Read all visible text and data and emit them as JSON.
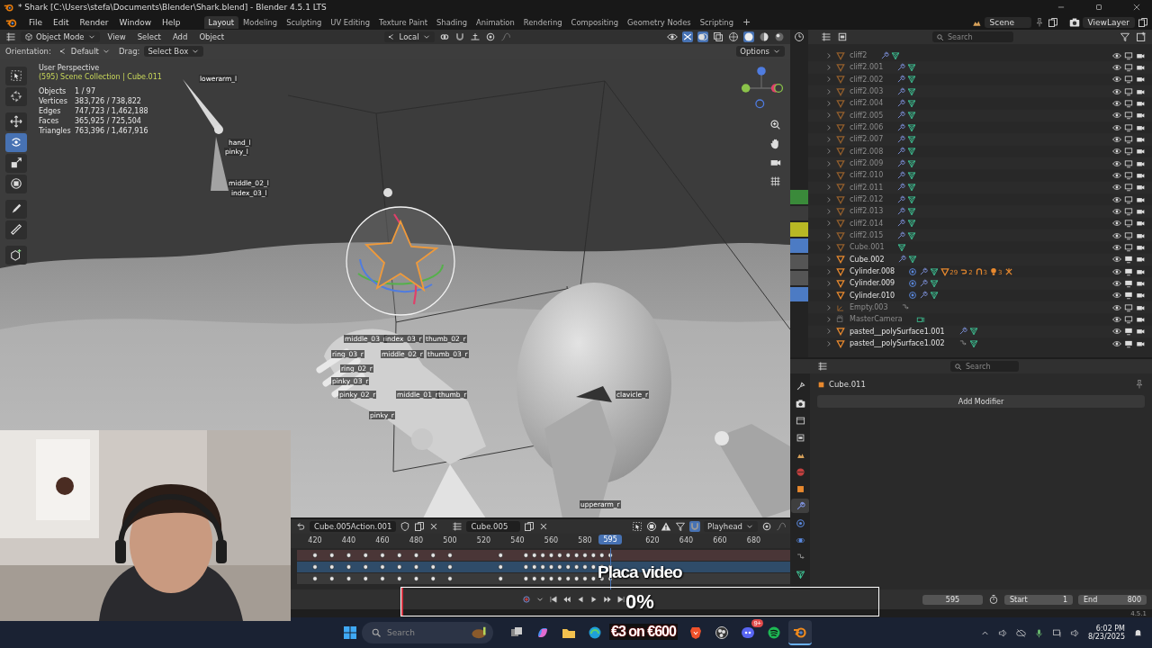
{
  "window": {
    "title": "* Shark [C:\\Users\\stefa\\Documents\\Blender\\Shark.blend] - Blender 4.5.1 LTS"
  },
  "menu": [
    "File",
    "Edit",
    "Render",
    "Window",
    "Help"
  ],
  "workspaces": [
    {
      "label": "Layout",
      "selected": true
    },
    {
      "label": "Modeling",
      "selected": false
    },
    {
      "label": "Sculpting",
      "selected": false
    },
    {
      "label": "UV Editing",
      "selected": false
    },
    {
      "label": "Texture Paint",
      "selected": false
    },
    {
      "label": "Shading",
      "selected": false
    },
    {
      "label": "Animation",
      "selected": false
    },
    {
      "label": "Rendering",
      "selected": false
    },
    {
      "label": "Compositing",
      "selected": false
    },
    {
      "label": "Geometry Nodes",
      "selected": false
    },
    {
      "label": "Scripting",
      "selected": false
    }
  ],
  "add_workspace": "+",
  "scene": {
    "value": "Scene"
  },
  "view_layer": {
    "value": "ViewLayer"
  },
  "viewport": {
    "header": {
      "mode": "Object Mode",
      "menus": [
        "View",
        "Select",
        "Add",
        "Object"
      ],
      "pivot": "Local"
    },
    "tool_settings": {
      "orientation_label": "Orientation:",
      "orientation": "Default",
      "drag_label": "Drag:",
      "drag": "Select Box",
      "options": "Options"
    },
    "tools": [
      {
        "kind": "select",
        "selected": false
      },
      {
        "kind": "cursor",
        "selected": false
      },
      {
        "kind": "move",
        "selected": false
      },
      {
        "kind": "rotate",
        "selected": true
      },
      {
        "kind": "scale",
        "selected": false
      },
      {
        "kind": "transform",
        "selected": false
      },
      {
        "kind": "annotate",
        "selected": false
      },
      {
        "kind": "measure",
        "selected": false
      },
      {
        "kind": "add-cube",
        "selected": false
      }
    ],
    "info": {
      "view": "User Perspective",
      "context": "(595) Scene Collection | Cube.011",
      "stats": [
        {
          "label": "Objects",
          "value": "1 / 97"
        },
        {
          "label": "Vertices",
          "value": "383,726 / 738,822"
        },
        {
          "label": "Edges",
          "value": "747,723 / 1,462,188"
        },
        {
          "label": "Faces",
          "value": "365,925 / 725,504"
        },
        {
          "label": "Triangles",
          "value": "763,396 / 1,467,916"
        }
      ]
    },
    "bone_labels": [
      "lowerarm_l",
      "hand_l",
      "pinky_l",
      "middle_02_l",
      "index_03_l",
      "middle_03_r",
      "index_03_r",
      "thumb_02_r",
      "ring_03_r",
      "middle_02_r",
      "thumb_03_r",
      "ring_02_r",
      "pinky_03_r",
      "pinky_02_r",
      "middle_01_r",
      "thumb_r",
      "clavicle_r",
      "pinky_r",
      "upperarm_r"
    ]
  },
  "outliner": {
    "search": {
      "placeholder": "Search"
    },
    "rows": [
      {
        "name": "cliff2",
        "kind": "mesh",
        "dimmed": true,
        "badges": [
          {
            "kind": "modifier"
          },
          {
            "kind": "mesh-data"
          }
        ]
      },
      {
        "name": "cliff2.001",
        "kind": "mesh",
        "dimmed": true,
        "badges": [
          {
            "kind": "modifier"
          },
          {
            "kind": "mesh-data"
          }
        ]
      },
      {
        "name": "cliff2.002",
        "kind": "mesh",
        "dimmed": true,
        "badges": [
          {
            "kind": "modifier"
          },
          {
            "kind": "mesh-data"
          }
        ]
      },
      {
        "name": "cliff2.003",
        "kind": "mesh",
        "dimmed": true,
        "badges": [
          {
            "kind": "modifier"
          },
          {
            "kind": "mesh-data"
          }
        ]
      },
      {
        "name": "cliff2.004",
        "kind": "mesh",
        "dimmed": true,
        "badges": [
          {
            "kind": "modifier"
          },
          {
            "kind": "mesh-data"
          }
        ]
      },
      {
        "name": "cliff2.005",
        "kind": "mesh",
        "dimmed": true,
        "badges": [
          {
            "kind": "modifier"
          },
          {
            "kind": "mesh-data"
          }
        ]
      },
      {
        "name": "cliff2.006",
        "kind": "mesh",
        "dimmed": true,
        "badges": [
          {
            "kind": "modifier"
          },
          {
            "kind": "mesh-data"
          }
        ]
      },
      {
        "name": "cliff2.007",
        "kind": "mesh",
        "dimmed": true,
        "badges": [
          {
            "kind": "modifier"
          },
          {
            "kind": "mesh-data"
          }
        ]
      },
      {
        "name": "cliff2.008",
        "kind": "mesh",
        "dimmed": true,
        "badges": [
          {
            "kind": "modifier"
          },
          {
            "kind": "mesh-data"
          }
        ]
      },
      {
        "name": "cliff2.009",
        "kind": "mesh",
        "dimmed": true,
        "badges": [
          {
            "kind": "modifier"
          },
          {
            "kind": "mesh-data"
          }
        ]
      },
      {
        "name": "cliff2.010",
        "kind": "mesh",
        "dimmed": true,
        "badges": [
          {
            "kind": "modifier"
          },
          {
            "kind": "mesh-data"
          }
        ]
      },
      {
        "name": "cliff2.011",
        "kind": "mesh",
        "dimmed": true,
        "badges": [
          {
            "kind": "modifier"
          },
          {
            "kind": "mesh-data"
          }
        ]
      },
      {
        "name": "cliff2.012",
        "kind": "mesh",
        "dimmed": true,
        "badges": [
          {
            "kind": "modifier"
          },
          {
            "kind": "mesh-data"
          }
        ]
      },
      {
        "name": "cliff2.013",
        "kind": "mesh",
        "dimmed": true,
        "badges": [
          {
            "kind": "modifier"
          },
          {
            "kind": "mesh-data"
          }
        ]
      },
      {
        "name": "cliff2.014",
        "kind": "mesh",
        "dimmed": true,
        "badges": [
          {
            "kind": "modifier"
          },
          {
            "kind": "mesh-data"
          }
        ]
      },
      {
        "name": "cliff2.015",
        "kind": "mesh",
        "dimmed": true,
        "badges": [
          {
            "kind": "modifier"
          },
          {
            "kind": "mesh-data"
          }
        ]
      },
      {
        "name": "Cube.001",
        "kind": "mesh",
        "dimmed": true,
        "badges": [
          {
            "kind": "mesh-data"
          }
        ]
      },
      {
        "name": "Cube.002",
        "kind": "mesh",
        "dimmed": false,
        "badges": [
          {
            "kind": "modifier"
          },
          {
            "kind": "mesh-data"
          }
        ]
      },
      {
        "name": "Cylinder.008",
        "kind": "mesh",
        "dimmed": false,
        "badges": [
          {
            "kind": "particles"
          },
          {
            "kind": "modifier"
          },
          {
            "kind": "mesh-data"
          },
          {
            "kind": "vertex-groups",
            "count": "29"
          },
          {
            "kind": "hook",
            "count": "2"
          },
          {
            "kind": "curve",
            "count": "3"
          },
          {
            "kind": "light",
            "count": "3"
          },
          {
            "kind": "pose"
          }
        ]
      },
      {
        "name": "Cylinder.009",
        "kind": "mesh",
        "dimmed": false,
        "badges": [
          {
            "kind": "particles"
          },
          {
            "kind": "modifier"
          },
          {
            "kind": "mesh-data"
          }
        ]
      },
      {
        "name": "Cylinder.010",
        "kind": "mesh",
        "dimmed": false,
        "badges": [
          {
            "kind": "particles"
          },
          {
            "kind": "modifier"
          },
          {
            "kind": "mesh-data"
          }
        ]
      },
      {
        "name": "Empty.003",
        "kind": "empty",
        "dimmed": true,
        "badges": [
          {
            "kind": "constraint"
          }
        ]
      },
      {
        "name": "MasterCamera",
        "kind": "camera",
        "dimmed": true,
        "badges": [
          {
            "kind": "camera-data"
          }
        ]
      },
      {
        "name": "pasted__polySurface1.001",
        "kind": "mesh",
        "dimmed": false,
        "badges": [
          {
            "kind": "modifier"
          },
          {
            "kind": "mesh-data"
          }
        ]
      },
      {
        "name": "pasted__polySurface1.002",
        "kind": "mesh",
        "dimmed": false,
        "badges": [
          {
            "kind": "constraint"
          },
          {
            "kind": "mesh-data"
          }
        ]
      }
    ]
  },
  "properties": {
    "search": {
      "placeholder": "Search"
    },
    "object": "Cube.011",
    "add_modifier": "Add Modifier",
    "tabs": [
      {
        "kind": "tool",
        "selected": false
      },
      {
        "kind": "render",
        "selected": false
      },
      {
        "kind": "output",
        "selected": false
      },
      {
        "kind": "view-layer",
        "selected": false
      },
      {
        "kind": "scene",
        "selected": false
      },
      {
        "kind": "world",
        "selected": false
      },
      {
        "kind": "object",
        "selected": false
      },
      {
        "kind": "modifier",
        "selected": true
      },
      {
        "kind": "particles",
        "selected": false
      },
      {
        "kind": "physics",
        "selected": false
      },
      {
        "kind": "constraint",
        "selected": false
      },
      {
        "kind": "mesh-data",
        "selected": false
      }
    ]
  },
  "timeline": {
    "action": "Cube.005Action.001",
    "object": "Cube.005",
    "snap": "Playhead",
    "ruler": [
      "420",
      "440",
      "460",
      "480",
      "500",
      "520",
      "540",
      "560",
      "580",
      "620",
      "640",
      "660",
      "680"
    ],
    "current_frame": "595",
    "channels": [
      {
        "color": "#4a3637"
      },
      {
        "color": "#2f4c69"
      },
      {
        "color": "#3a3a3a"
      }
    ]
  },
  "playback": {
    "frame": "595",
    "start_label": "Start",
    "start": "1",
    "end_label": "End",
    "end": "800"
  },
  "status": {
    "version": "4.5.1"
  },
  "stream_overlay": {
    "caption": "Placa video",
    "progress": "0%",
    "level": 0,
    "goal": "€3 on €600"
  },
  "taskbar": {
    "search": {
      "placeholder": "Search"
    },
    "apps": [
      {
        "kind": "task-view",
        "active": false
      },
      {
        "kind": "copilot",
        "active": false
      },
      {
        "kind": "folder",
        "active": false
      },
      {
        "kind": "edge",
        "active": false
      },
      {
        "kind": "brave",
        "active": false
      },
      {
        "kind": "obs",
        "active": false
      },
      {
        "kind": "discord",
        "active": false,
        "badge": "9+"
      },
      {
        "kind": "spotify",
        "active": false
      },
      {
        "kind": "blender",
        "active": true
      }
    ],
    "time": "6:02 PM",
    "date": "8/23/2025"
  }
}
